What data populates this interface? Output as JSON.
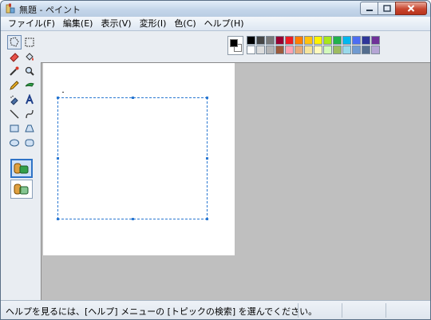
{
  "window": {
    "title": "無題 - ペイント"
  },
  "menu": [
    {
      "label": "ファイル(F)",
      "name": "menu-file"
    },
    {
      "label": "編集(E)",
      "name": "menu-edit"
    },
    {
      "label": "表示(V)",
      "name": "menu-view"
    },
    {
      "label": "変形(I)",
      "name": "menu-image"
    },
    {
      "label": "色(C)",
      "name": "menu-colors"
    },
    {
      "label": "ヘルプ(H)",
      "name": "menu-help"
    }
  ],
  "tools": [
    {
      "name": "free-select-icon",
      "selected": true
    },
    {
      "name": "rect-select-icon",
      "selected": false
    },
    {
      "name": "eraser-icon",
      "selected": false
    },
    {
      "name": "fill-bucket-icon",
      "selected": false
    },
    {
      "name": "color-picker-icon",
      "selected": false
    },
    {
      "name": "magnifier-icon",
      "selected": false
    },
    {
      "name": "pencil-icon",
      "selected": false
    },
    {
      "name": "brush-icon",
      "selected": false
    },
    {
      "name": "airbrush-icon",
      "selected": false
    },
    {
      "name": "text-tool-icon",
      "selected": false
    },
    {
      "name": "line-icon",
      "selected": false
    },
    {
      "name": "curve-icon",
      "selected": false
    },
    {
      "name": "rectangle-icon",
      "selected": false
    },
    {
      "name": "polygon-icon",
      "selected": false
    },
    {
      "name": "ellipse-icon",
      "selected": false
    },
    {
      "name": "rounded-rect-icon",
      "selected": false
    }
  ],
  "palette": {
    "foreground": "#000000",
    "background": "#ffffff",
    "top_row": [
      "#000000",
      "#464646",
      "#787878",
      "#990030",
      "#ed1c24",
      "#ff7e00",
      "#ffc20e",
      "#fff200",
      "#a8e61d",
      "#22b14c",
      "#00b7ef",
      "#4d6df3",
      "#2f3699",
      "#6f3198"
    ],
    "bottom_row": [
      "#ffffff",
      "#dcdcdc",
      "#b4b4b4",
      "#9c5a3c",
      "#ffa3b1",
      "#e5aa7a",
      "#f5e49c",
      "#fff9bd",
      "#d3f9bc",
      "#9dbb61",
      "#99d9ea",
      "#709ad1",
      "#546d8e",
      "#b5a5d5"
    ]
  },
  "status": {
    "help_text": "ヘルプを見るには、[ヘルプ] メニューの [トピックの検索] を選んでください。"
  }
}
